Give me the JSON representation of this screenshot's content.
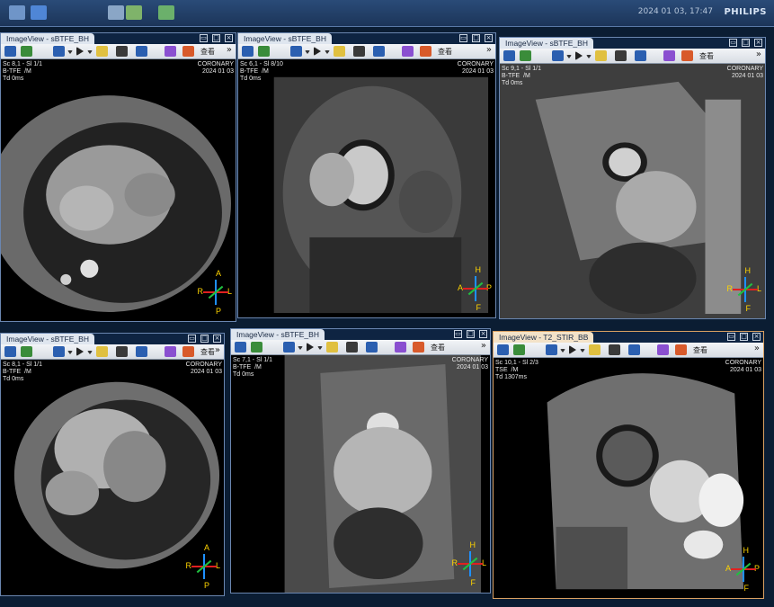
{
  "app": {
    "brand": "PHILIPS",
    "datetime": "2024 01 03, 17:47"
  },
  "viewports": [
    {
      "title": "ImageView - sBTFE_BH",
      "active": false,
      "toolbar_label": "查看",
      "ov_tl": "Sc 8,1 - Sl 1/1\nB-TFE  /M\nTd 0ms",
      "ov_tr": "CORONARY\n2024 01 03",
      "orient": {
        "top": "A",
        "left": "R",
        "right": "L",
        "bottom": "P"
      }
    },
    {
      "title": "ImageView - sBTFE_BH",
      "active": false,
      "toolbar_label": "查看",
      "ov_tl": "Sc 6,1 - Sl 8/10\nB-TFE  /M\nTd 0ms",
      "ov_tr": "CORONARY\n2024 01 03",
      "orient": {
        "top": "H",
        "left": "A",
        "right": "P",
        "bottom": "F"
      }
    },
    {
      "title": "ImageView - sBTFE_BH",
      "active": false,
      "toolbar_label": "查看",
      "ov_tl": "Sc 9,1 - Sl 1/1\nB-TFE  /M\nTd 0ms",
      "ov_tr": "CORONARY\n2024 01 03",
      "orient": {
        "top": "H",
        "left": "R",
        "right": "L",
        "bottom": "F"
      }
    },
    {
      "title": "ImageView - sBTFE_BH",
      "active": false,
      "toolbar_label": "查看",
      "ov_tl": "Sc 8,1 - Sl 1/1\nB-TFE  /M\nTd 0ms",
      "ov_tr": "CORONARY\n2024 01 03",
      "orient": {
        "top": "A",
        "left": "R",
        "right": "L",
        "bottom": "P"
      }
    },
    {
      "title": "ImageView - sBTFE_BH",
      "active": false,
      "toolbar_label": "查看",
      "ov_tl": "Sc 7,1 - Sl 1/1\nB-TFE  /M\nTd 0ms",
      "ov_tr": "CORONARY\n2024 01 03",
      "orient": {
        "top": "H",
        "left": "R",
        "right": "L",
        "bottom": "F"
      }
    },
    {
      "title": "ImageView - T2_STIR_BB",
      "active": true,
      "toolbar_label": "查看",
      "ov_tl": "Sc 10,1 - Sl 2/3\nTSE  /M\nTd 1307ms",
      "ov_tr": "CORONARY\n2024 01 03",
      "orient": {
        "top": "H",
        "left": "A",
        "right": "P",
        "bottom": "F"
      }
    }
  ]
}
